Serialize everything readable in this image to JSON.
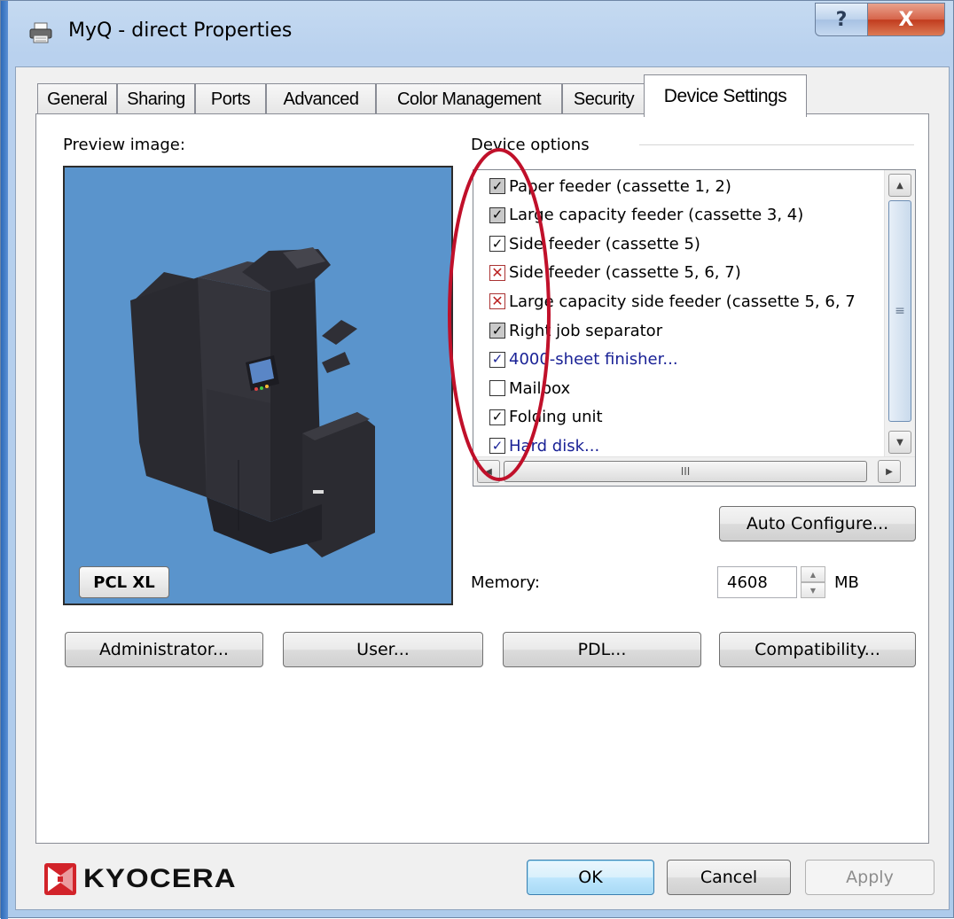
{
  "window": {
    "title": "MyQ - direct Properties",
    "help_glyph": "?",
    "close_glyph": "X"
  },
  "tabs": [
    "General",
    "Sharing",
    "Ports",
    "Advanced",
    "Color Management",
    "Security",
    "Device Settings"
  ],
  "active_tab": "Device Settings",
  "preview": {
    "label": "Preview image:",
    "pdl_badge": "PCL XL"
  },
  "device_options": {
    "label": "Device options",
    "items": [
      {
        "label": "Paper feeder (cassette 1, 2)",
        "state": "checked-gray",
        "link": false
      },
      {
        "label": "Large capacity feeder (cassette 3, 4)",
        "state": "checked-gray",
        "link": false
      },
      {
        "label": "Side feeder (cassette 5)",
        "state": "checked",
        "link": false
      },
      {
        "label": "Side feeder (cassette 5, 6, 7)",
        "state": "unavailable",
        "link": false
      },
      {
        "label": "Large capacity side feeder (cassette 5, 6, 7",
        "state": "unavailable",
        "link": false
      },
      {
        "label": "Right job separator",
        "state": "checked-gray",
        "link": false
      },
      {
        "label": "4000-sheet finisher...",
        "state": "checked",
        "link": true
      },
      {
        "label": "Mailbox",
        "state": "unchecked",
        "link": false
      },
      {
        "label": "Folding unit",
        "state": "checked",
        "link": false
      },
      {
        "label": "Hard disk...",
        "state": "checked",
        "link": true
      }
    ],
    "hscroll_grip": "III",
    "vscroll_grip": "≡"
  },
  "auto_configure_label": "Auto Configure...",
  "memory": {
    "label": "Memory:",
    "value": "4608",
    "unit": "MB"
  },
  "buttons": {
    "administrator": "Administrator...",
    "user": "User...",
    "pdl": "PDL...",
    "compatibility": "Compatibility..."
  },
  "footer": {
    "brand": "KYOCERA",
    "ok": "OK",
    "cancel": "Cancel",
    "apply": "Apply"
  },
  "colors": {
    "preview_bg": "#5a94cc",
    "link": "#1a2296",
    "annotation": "#c0102a",
    "brand_red": "#d2232a"
  }
}
